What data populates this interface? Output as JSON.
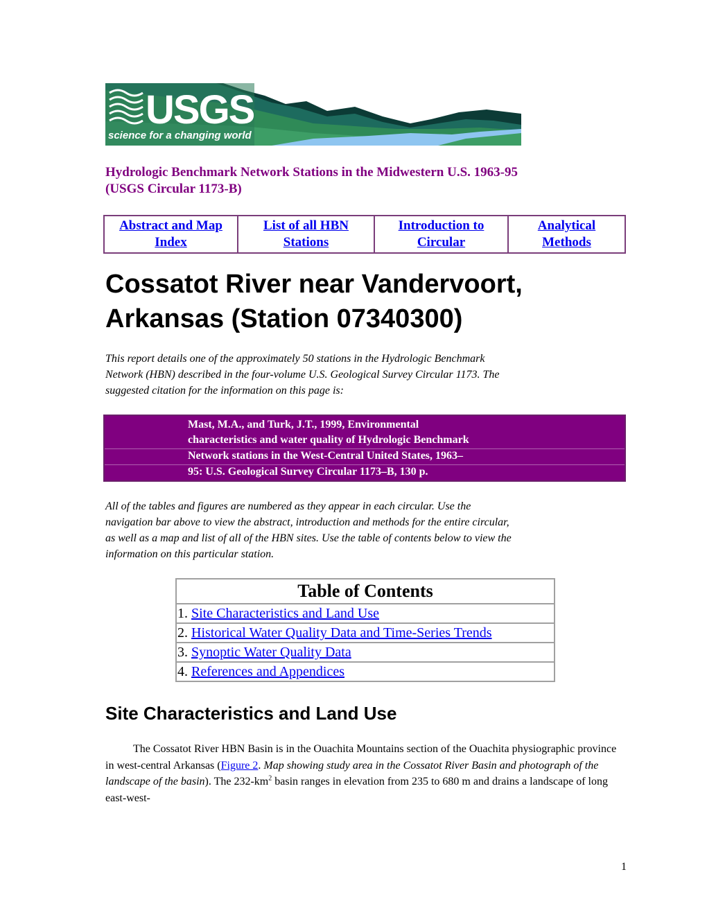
{
  "banner": {
    "logo_text": "USGS",
    "tagline": "science for a changing world"
  },
  "subtitle": {
    "line1": "Hydrologic Benchmark Network Stations in the Midwestern U.S. 1963-95",
    "line2": "(USGS Circular 1173-B)"
  },
  "nav": {
    "items": [
      {
        "line1": "Abstract and Map",
        "line2": "Index"
      },
      {
        "line1": "List of all HBN",
        "line2": "Stations"
      },
      {
        "line1": "Introduction to",
        "line2": "Circular"
      },
      {
        "line1": "Analytical",
        "line2": "Methods"
      }
    ]
  },
  "title": {
    "line1": "Cossatot River near Vandervoort,",
    "line2": "Arkansas (Station 07340300)"
  },
  "intro": {
    "lines": [
      "This report details one of the approximately 50 stations in the Hydrologic Benchmark",
      "Network (HBN) described in the four-volume U.S. Geological Survey Circular 1173. The",
      "suggested citation for the information on this page is:"
    ]
  },
  "citation": {
    "lines": [
      "Mast, M.A., and Turk, J.T., 1999, Environmental",
      "characteristics and water quality of Hydrologic Benchmark",
      "Network stations in the West-Central United States, 1963–",
      "95: U.S. Geological Survey Circular 1173–B, 130 p."
    ]
  },
  "explain": {
    "lines": [
      "All of the tables and figures are numbered as they appear in each circular.  Use the",
      "navigation bar above to view the abstract, introduction and methods for the entire circular,",
      "as well as a map and list of all of the HBN sites.  Use the table of contents below to view the",
      "information on this particular station."
    ]
  },
  "toc": {
    "heading": "Table of Contents",
    "items": [
      {
        "num": "1. ",
        "label": "Site Characteristics and Land Use"
      },
      {
        "num": "2. ",
        "label": "Historical Water Quality Data and Time-Series Trends"
      },
      {
        "num": "3. ",
        "label": "Synoptic Water Quality Data"
      },
      {
        "num": "4. ",
        "label": "References and Appendices"
      }
    ]
  },
  "section": {
    "heading": "Site Characteristics and Land Use",
    "p1": "The Cossatot River HBN Basin is in the Ouachita Mountains section of the Ouachita physiographic province in west-central Arkansas (",
    "figure_link": "Figure 2",
    "p2": ". ",
    "figure_caption": "Map showing study area in the Cossatot River Basin and photograph of the landscape of the basin",
    "p3": "). The 232-km",
    "sup": "2",
    "p4": " basin ranges in elevation from 235 to 680 m and drains a landscape of long east-west-"
  },
  "page_number": "1",
  "colors": {
    "accent_purple": "#800080",
    "link_blue": "#0000ee",
    "usgs_green": "#2e7d4f"
  }
}
